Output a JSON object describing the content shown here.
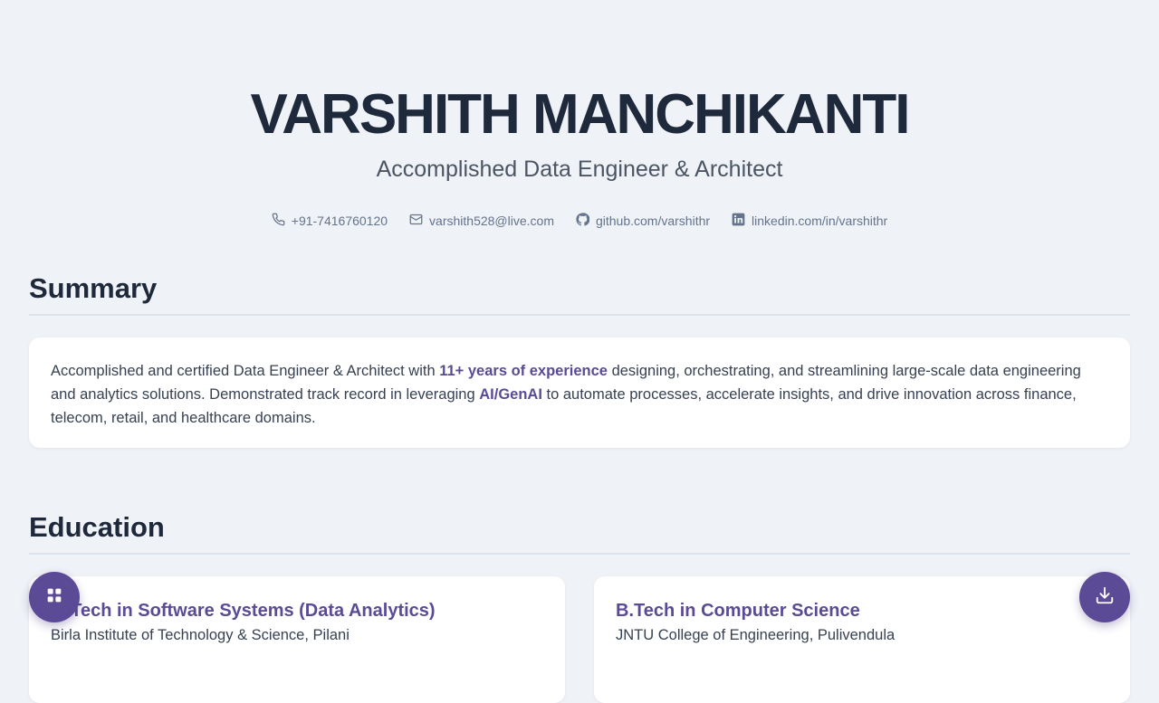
{
  "profile": {
    "name": "VARSHITH MANCHIKANTI",
    "tagline": "Accomplished Data Engineer & Architect"
  },
  "contacts": {
    "phone": "+91-7416760120",
    "email": "varshith528@live.com",
    "github": "github.com/varshithr",
    "linkedin": "linkedin.com/in/varshithr"
  },
  "summary": {
    "title": "Summary",
    "text_1": "Accomplished and certified Data Engineer & Architect with ",
    "highlight_1": "11+ years of experience",
    "text_2": " designing, orchestrating, and streamlining large-scale data engineering and analytics solutions. Demonstrated track record in leveraging ",
    "highlight_2": "AI/GenAI",
    "text_3": " to automate processes, accelerate insights, and drive innovation across finance, telecom, retail, and healthcare domains."
  },
  "education": {
    "title": "Education",
    "items": [
      {
        "degree": "M.Tech in Software Systems (Data Analytics)",
        "school": "Birla Institute of Technology & Science, Pilani"
      },
      {
        "degree": "B.Tech in Computer Science",
        "school": "JNTU College of Engineering, Pulivendula"
      }
    ]
  },
  "icons": {
    "phone": "phone-icon",
    "email": "mail-icon",
    "github": "github-icon",
    "linkedin": "linkedin-icon",
    "menu": "grid-menu-icon",
    "download": "download-icon"
  },
  "colors": {
    "accent": "#5b4a95",
    "heading": "#1e293b",
    "background": "#eff2f7"
  }
}
